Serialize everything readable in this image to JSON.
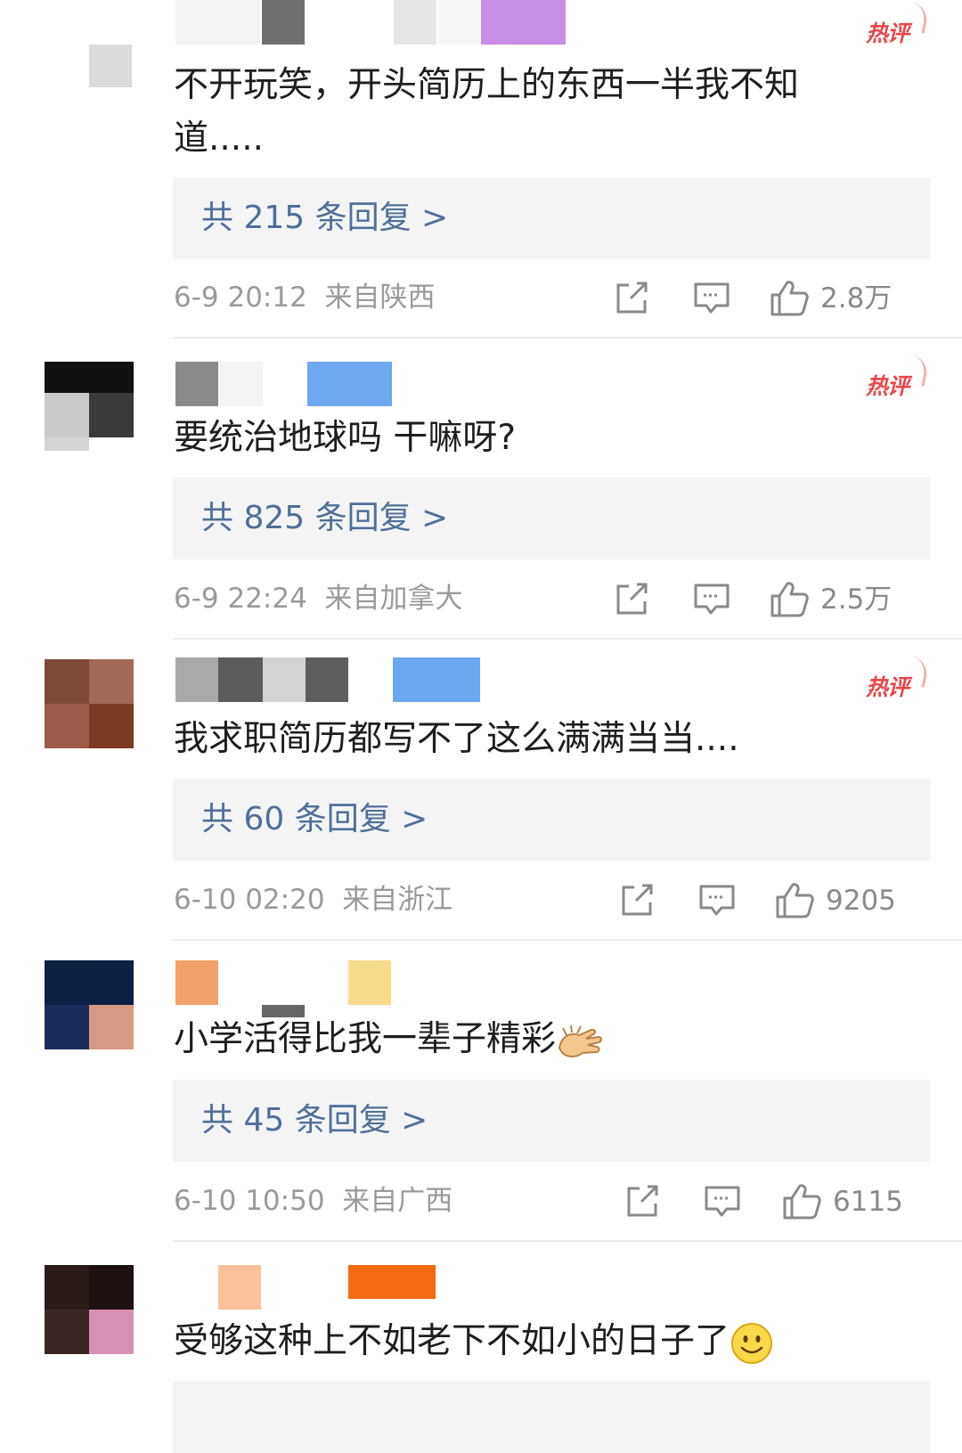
{
  "comments": [
    {
      "hot_label": "热评",
      "text": "不开玩笑，开头简历上的东西一半我不知道.....",
      "reply_label": "共 215 条回复 >",
      "time": "6-9 20:12",
      "location": "来自陕西",
      "likes": "2.8万"
    },
    {
      "hot_label": "热评",
      "text": "要统治地球吗 干嘛呀?",
      "reply_label": "共 825 条回复 >",
      "time": "6-9 22:24",
      "location": "来自加拿大",
      "likes": "2.5万"
    },
    {
      "hot_label": "热评",
      "text": "我求职简历都写不了这么满满当当....",
      "reply_label": "共 60 条回复 >",
      "time": "6-10 02:20",
      "location": "来自浙江",
      "likes": "9205"
    },
    {
      "text": "小学活得比我一辈子精彩",
      "emoji": "clapping-hand-icon",
      "reply_label": "共 45 条回复 >",
      "time": "6-10 10:50",
      "location": "来自广西",
      "likes": "6115"
    },
    {
      "text": "受够这种上不如老下不如小的日子了",
      "emoji": "smile-face-icon"
    }
  ],
  "colors": {
    "hot": "#e8474a",
    "reply_text": "#4f6f9a",
    "reply_bg": "#f4f4f4",
    "meta": "#9a9a9a"
  }
}
